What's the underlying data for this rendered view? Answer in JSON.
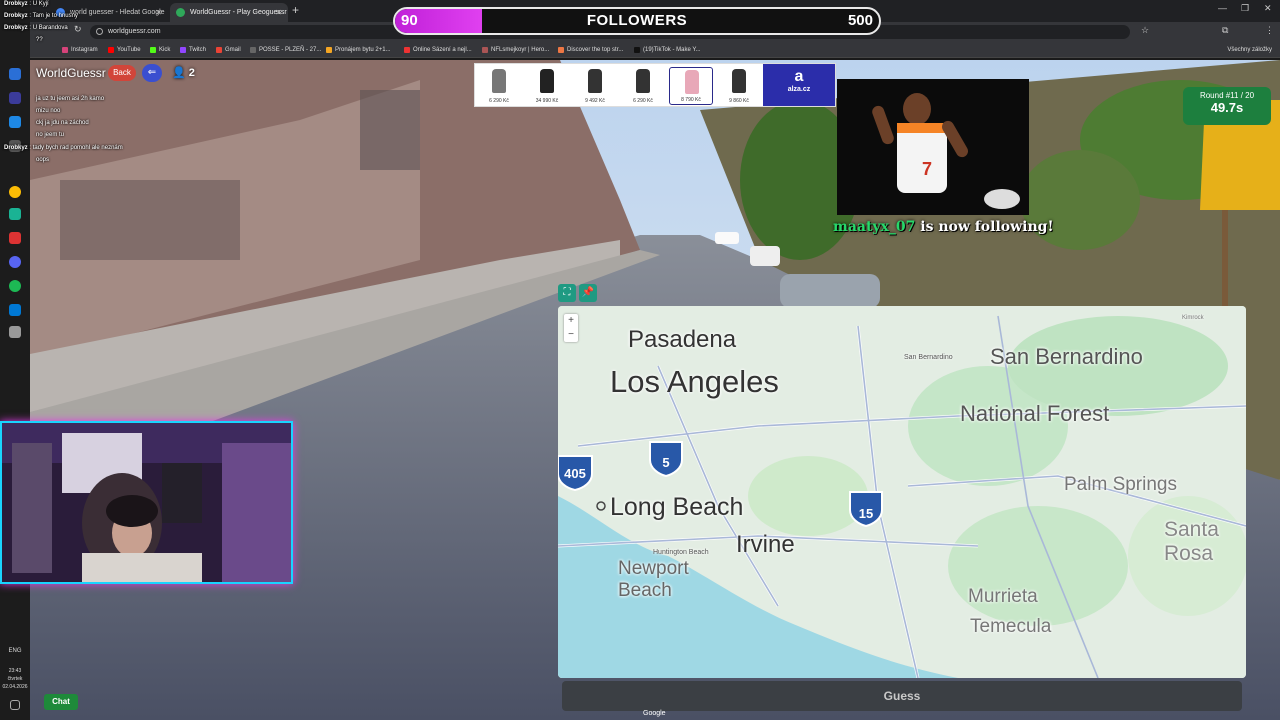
{
  "browser": {
    "tabs": [
      {
        "title": "world guesser - Hledat Google"
      },
      {
        "title": "WorldGuessr - Play Geoguessr"
      }
    ],
    "url": "worldguessr.com",
    "bookmarks": [
      "Instagram",
      "YouTube",
      "Kick",
      "Twitch",
      "Gmail",
      "POSSE - PLZEŇ - 27...",
      "Pronájem bytu 2+1...",
      "Online Sázení a nejl...",
      "NFLsmejkoyr | Hero...",
      "Discover the top str...",
      "(19)TikTok - Make Y..."
    ],
    "bookmarks_folder": "Všechny záložky"
  },
  "stream_chat": [
    {
      "user": "Drobkyz",
      "text": "U Kyjí"
    },
    {
      "user": "Drobkyz",
      "text": "Tam je to hnusný"
    },
    {
      "user": "Drobkyz",
      "text": "U Barandova"
    },
    {
      "user": "",
      "text": "??"
    },
    {
      "user": "",
      "text": "ja uz tu jeem asi 2h kamo"
    },
    {
      "user": "",
      "text": "mizu noo"
    },
    {
      "user": "",
      "text": "ckj ja jdu na záchod"
    },
    {
      "user": "",
      "text": "no jeem tu"
    },
    {
      "user": "Drobkyz",
      "text": "tady bych rad pomohl ale neznám"
    },
    {
      "user": "",
      "text": "oops"
    }
  ],
  "followers_goal": {
    "current": "90",
    "label": "FOLLOWERS",
    "goal": "500",
    "progress": 0.18
  },
  "game": {
    "logo": "WorldGuessr",
    "back_label": "Back",
    "players": "2",
    "round_label": "Round #11 / 20",
    "timer": "49.7s",
    "guess_label": "Guess",
    "attribution": "Google"
  },
  "ad": {
    "prices": [
      "6 290 Kč",
      "34 990 Kč",
      "9 492 Kč",
      "6 290 Kč",
      "8 790 Kč",
      "9 860 Kč"
    ],
    "brand": "alza.cz"
  },
  "alert": {
    "user": "maatyx_07",
    "text": "is now following!"
  },
  "map": {
    "labels": [
      {
        "text": "Pasadena",
        "size": "large"
      },
      {
        "text": "Los Angeles",
        "size": "xl"
      },
      {
        "text": "San Bernardino",
        "size": "xl"
      },
      {
        "text": "National Forest",
        "size": "xl"
      },
      {
        "text": "Long Beach",
        "size": "xl"
      },
      {
        "text": "Irvine",
        "size": "xl"
      },
      {
        "text": "Newport Beach",
        "size": "large"
      },
      {
        "text": "Palm Springs",
        "size": "large"
      },
      {
        "text": "Murrieta",
        "size": "large"
      },
      {
        "text": "Temecula",
        "size": "large"
      },
      {
        "text": "Santa Rosa",
        "size": "xl"
      },
      {
        "text": "San Bernardino",
        "size": "small"
      },
      {
        "text": "Huntington Beach",
        "size": "small"
      },
      {
        "text": "Kimrock",
        "size": "small"
      }
    ],
    "shields": [
      "405",
      "5",
      "15"
    ]
  },
  "taskbar": {
    "lang": "ENG",
    "time": "23:43",
    "day": "čtvrtek",
    "date": "02.04.2026",
    "chat_label": "Chat"
  },
  "colors": {
    "accent_green": "#1d7f3e",
    "follow_bar": "#d82ee8",
    "cam_border": "#19d4ff",
    "guess_btn": "#3b3f44"
  }
}
